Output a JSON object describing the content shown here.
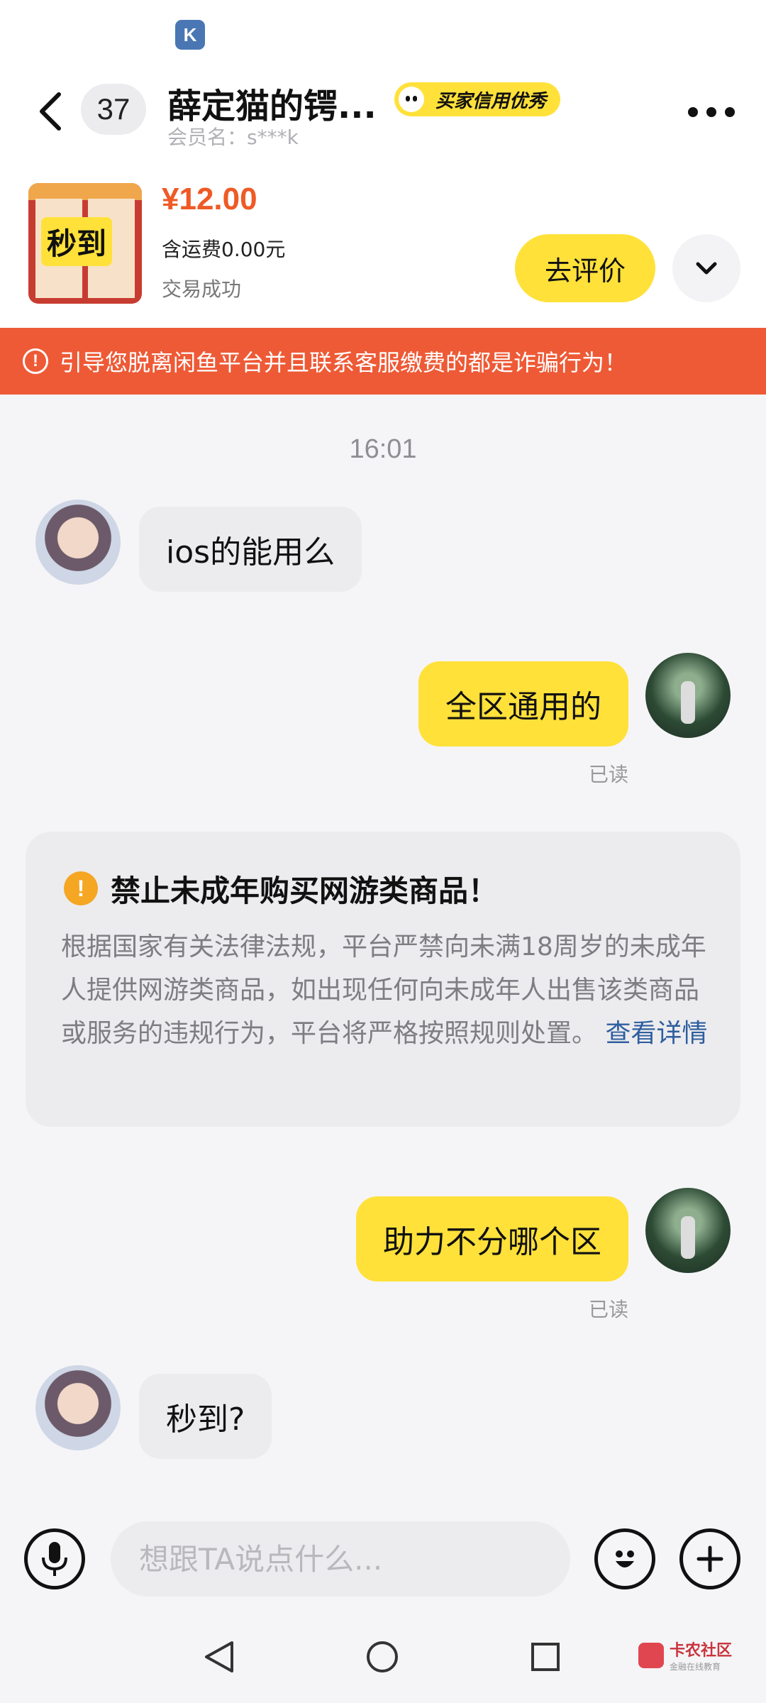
{
  "status_bar": {
    "app_icon_letter": "K"
  },
  "header": {
    "unread_count": "37",
    "chat_name": "薛定猫的锷...",
    "credit_badge": "买家信用优秀",
    "member_label": "会员名：s***k"
  },
  "product": {
    "thumbnail_label": "秒到",
    "price": "¥12.00",
    "shipping": "含运费0.00元",
    "status": "交易成功",
    "review_button": "去评价"
  },
  "warning_banner": {
    "icon": "!",
    "text": "引导您脱离闲鱼平台并且联系客服缴费的都是诈骗行为！"
  },
  "chat": {
    "timestamp": "16:01",
    "messages": [
      {
        "side": "in",
        "text": "ios的能用么"
      },
      {
        "side": "out",
        "text": "全区通用的",
        "receipt": "已读"
      },
      {
        "side": "out",
        "text": "助力不分哪个区",
        "receipt": "已读"
      },
      {
        "side": "in",
        "text": "秒到?"
      }
    ],
    "notice": {
      "icon": "!",
      "title": "禁止未成年购买网游类商品！",
      "body": "根据国家有关法律法规，平台严禁向未满18周岁的未成年人提供网游类商品，如出现任何向未成年人出售该类商品或服务的违规行为，平台将严格按照规则处置。",
      "link": "查看详情"
    }
  },
  "input_bar": {
    "placeholder": "想跟TA说点什么..."
  },
  "watermark": {
    "title": "卡农社区",
    "subtitle": "金融在线教育"
  },
  "colors": {
    "accent_yellow": "#ffe13a",
    "warning_orange": "#ee5a36",
    "price_orange": "#ef5a26",
    "link_blue": "#2f5e9e"
  }
}
